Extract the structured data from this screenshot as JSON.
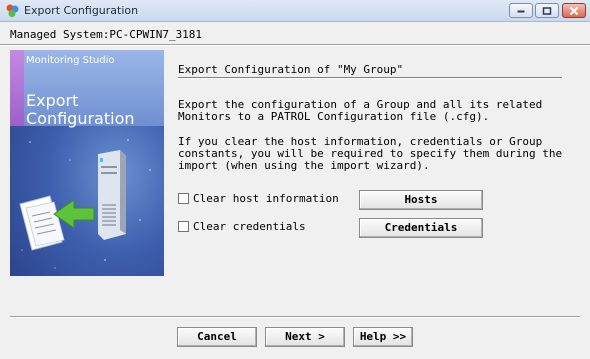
{
  "window": {
    "title": "Export Configuration",
    "icon": "app-icon"
  },
  "managed_system": "Managed System:PC-CPWIN7_3181",
  "banner": {
    "studio": "Monitoring Studio",
    "title": "Export Configuration"
  },
  "content": {
    "heading": "Export Configuration of \"My Group\"",
    "para1": "Export the configuration of a Group and all its related\nMonitors to a PATROL Configuration file (.cfg).",
    "para2": "If you clear the host information, credentials or Group\nconstants, you will be required to specify them during the\nimport (when using the import wizard)."
  },
  "options": {
    "clear_host": {
      "label": "Clear host information",
      "checked": false
    },
    "clear_credentials": {
      "label": "Clear credentials",
      "checked": false
    }
  },
  "buttons": {
    "hosts": "Hosts",
    "credentials": "Credentials",
    "cancel": "Cancel",
    "next": "Next >",
    "help": "Help >>"
  }
}
